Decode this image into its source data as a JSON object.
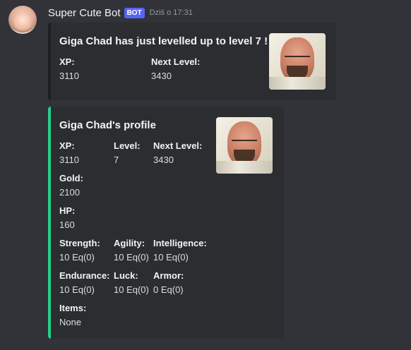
{
  "author": {
    "name": "Super Cute Bot",
    "bot_tag": "BOT",
    "timestamp": "Dziś o 17:31"
  },
  "level_embed": {
    "title": "Giga Chad has just levelled up to level 7 !",
    "fields": [
      {
        "name": "XP:",
        "value": "3110"
      },
      {
        "name": "Next Level:",
        "value": "3430"
      }
    ],
    "thumbnail_icon": "bald-man-portrait"
  },
  "profile_embed": {
    "accent_color": "#23d18b",
    "title": "Giga Chad's profile",
    "xp": {
      "name": "XP:",
      "value": "3110"
    },
    "level": {
      "name": "Level:",
      "value": "7"
    },
    "next_level": {
      "name": "Next Level:",
      "value": "3430"
    },
    "gold": {
      "name": "Gold:",
      "value": "2100"
    },
    "hp": {
      "name": "HP:",
      "value": "160"
    },
    "strength": {
      "name": "Strength:",
      "value": "10 Eq(0)"
    },
    "agility": {
      "name": "Agility:",
      "value": "10 Eq(0)"
    },
    "intelligence": {
      "name": "Intelligence:",
      "value": "10 Eq(0)"
    },
    "endurance": {
      "name": "Endurance:",
      "value": "10 Eq(0)"
    },
    "luck": {
      "name": "Luck:",
      "value": "10 Eq(0)"
    },
    "armor": {
      "name": "Armor:",
      "value": "0 Eq(0)"
    },
    "items": {
      "name": "Items:",
      "value": "None"
    },
    "thumbnail_icon": "bald-man-portrait"
  },
  "colors": {
    "background": "#313338",
    "embed_background": "#2b2d31",
    "bot_tag": "#5865f2"
  }
}
